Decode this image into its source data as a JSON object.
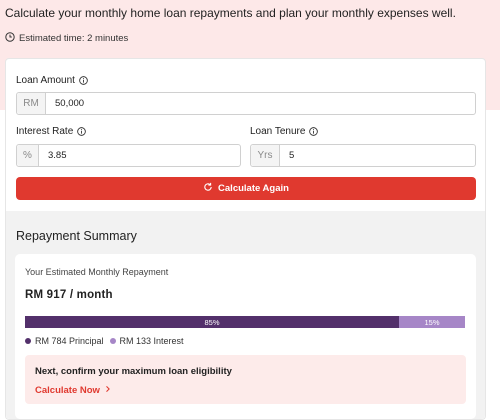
{
  "hero": {
    "headline": "Calculate your monthly home loan repayments and plan your monthly expenses well.",
    "estimated_time": "Estimated time: 2 minutes"
  },
  "form": {
    "loan_amount": {
      "label": "Loan Amount",
      "prefix": "RM",
      "value": "50,000"
    },
    "interest_rate": {
      "label": "Interest Rate",
      "prefix": "%",
      "value": "3.85"
    },
    "loan_tenure": {
      "label": "Loan Tenure",
      "prefix": "Yrs",
      "value": "5"
    },
    "calculate_label": "Calculate Again"
  },
  "summary": {
    "title": "Repayment Summary",
    "monthly_label": "Your Estimated Monthly Repayment",
    "monthly_value": "RM 917 / month",
    "breakdown": {
      "principal_percent": 85,
      "interest_percent": 15,
      "principal_text": "85%",
      "interest_text": "15%"
    },
    "legend": {
      "principal": "RM 784 Principal",
      "interest": "RM 133 Interest"
    },
    "cta": {
      "title": "Next, confirm your maximum loan eligibility",
      "link": "Calculate Now"
    }
  },
  "colors": {
    "accent": "#e0392f",
    "principal": "#53306b",
    "interest": "#a686c7",
    "hero_bg": "#fde8e8"
  },
  "icons": {
    "time": "clock-icon",
    "info": "info-icon",
    "refresh": "refresh-icon",
    "link": "chevron-right-icon"
  }
}
